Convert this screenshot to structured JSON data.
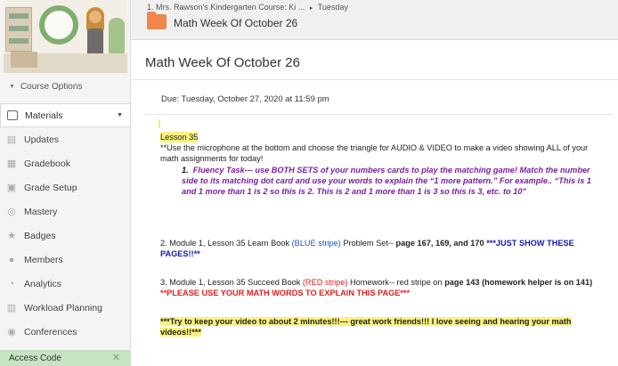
{
  "breadcrumb": {
    "course": "1. Mrs. Rawson's Kindergarten Course: Ki ...",
    "sep": "▸",
    "current": "Tuesday"
  },
  "folder_title": "Math Week Of October 26",
  "page_title": "Math Week Of October 26",
  "sidebar": {
    "course_options": "Course Options",
    "items": [
      {
        "label": "Materials",
        "icon": "materials-icon",
        "active": true
      },
      {
        "label": "Updates",
        "icon": "updates-icon"
      },
      {
        "label": "Gradebook",
        "icon": "gradebook-icon"
      },
      {
        "label": "Grade Setup",
        "icon": "grade-setup-icon"
      },
      {
        "label": "Mastery",
        "icon": "mastery-icon"
      },
      {
        "label": "Badges",
        "icon": "badges-icon"
      },
      {
        "label": "Members",
        "icon": "members-icon"
      },
      {
        "label": "Analytics",
        "icon": "analytics-icon"
      },
      {
        "label": "Workload Planning",
        "icon": "workload-icon"
      },
      {
        "label": "Conferences",
        "icon": "conferences-icon"
      }
    ],
    "access_code": "Access Code"
  },
  "assignment": {
    "due": "Due: Tuesday, October 27, 2020 at 11:59 pm",
    "lesson": "Lesson 35",
    "intro": "**Use the microphone at the bottom and choose the triangle for AUDIO & VIDEO to make a video showing ALL of your math assignments for today!",
    "fluency_num": "1.",
    "fluency_title": "Fluency Task---",
    "fluency_text": " use BOTH SETS of your numbers cards to play the matching game! Match the number side to its matching dot card and use your words to explain the “1 more pattern.”  For example.. “This is 1 and 1 more than 1 is 2 so this is 2.  This is 2 and 1 more than 1 is 3 so this is 3, etc. to 10”",
    "item2_prefix": "2.  Module 1, Lesson 35 Learn Book ",
    "item2_stripe": "(BLUE stripe)",
    "item2_mid": " Problem Set-- ",
    "item2_pages": "page 167, 169, and 170",
    "item2_note": "  ***JUST SHOW THESE PAGES!!**",
    "item3_prefix": "3. Module 1, Lesson 35 Succeed Book ",
    "item3_stripe": "(RED stripe)",
    "item3_mid": " Homework-- red stripe on ",
    "item3_page": "page 143",
    "item3_helper": "  (homework helper is on 141)",
    "item3_note": " **PLEASE USE YOUR MATH WORDS TO EXPLAIN THIS PAGE***",
    "closing": "***Try to keep your video to about 2 minutes!!!--- great work friends!!!  I love seeing and hearing your math videos!!***"
  }
}
